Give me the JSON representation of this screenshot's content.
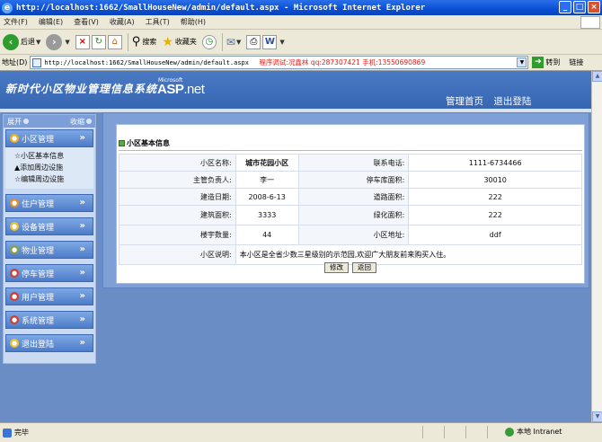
{
  "window": {
    "title": "http://localhost:1662/SmallHouseNew/admin/default.aspx - Microsoft Internet Explorer",
    "min": "_",
    "max": "□",
    "close": "×"
  },
  "menubar": [
    "文件(F)",
    "编辑(E)",
    "查看(V)",
    "收藏(A)",
    "工具(T)",
    "帮助(H)"
  ],
  "toolbar": {
    "back": "后退",
    "search": "搜索",
    "favorites": "收藏夹"
  },
  "address": {
    "label": "地址(D)",
    "url": "http://localhost:1662/SmallHouseNew/admin/default.aspx",
    "note": "程序调试:况鑫林  qq:287307421  手机:13550690869",
    "go": "转到",
    "links": "链接"
  },
  "header": {
    "system_title": "新时代小区物业管理信息系统",
    "asp_ms": "Microsoft",
    "asp_main": "ASP",
    "asp_net": ".net",
    "links": [
      "管理首页",
      "退出登陆"
    ]
  },
  "sidebar": {
    "expand": "展开",
    "collapse": "收缩",
    "menus": [
      {
        "label": "小区管理",
        "subs": [
          "☆小区基本信息",
          "▲添加周边设施",
          "☆编辑周边设施"
        ]
      },
      {
        "label": "住户管理",
        "subs": []
      },
      {
        "label": "设备管理",
        "subs": []
      },
      {
        "label": "物业管理",
        "subs": []
      },
      {
        "label": "停车管理",
        "subs": []
      },
      {
        "label": "用户管理",
        "subs": []
      },
      {
        "label": "系统管理",
        "subs": []
      },
      {
        "label": "退出登陆",
        "subs": []
      }
    ]
  },
  "main": {
    "section_title": "小区基本信息",
    "rows": [
      {
        "l1": "小区名称:",
        "v1": "城市花园小区",
        "l2": "联系电话:",
        "v2": "1111-6734466"
      },
      {
        "l1": "主管负责人:",
        "v1": "李一",
        "l2": "停车库面积:",
        "v2": "30010"
      },
      {
        "l1": "建造日期:",
        "v1": "2008-6-13",
        "l2": "道路面积:",
        "v2": "222"
      },
      {
        "l1": "建筑面积:",
        "v1": "3333",
        "l2": "绿化面积:",
        "v2": "222"
      },
      {
        "l1": "楼宇数量:",
        "v1": "44",
        "l2": "小区地址:",
        "v2": "ddf"
      }
    ],
    "desc_label": "小区说明:",
    "desc_value": "本小区是全省少数三星级别的示范园,欢迎广大朋友前来购买入住。",
    "edit_button": "修改",
    "back_button": "返回"
  },
  "status": {
    "text": "完毕",
    "zone": "本地 Intranet"
  }
}
